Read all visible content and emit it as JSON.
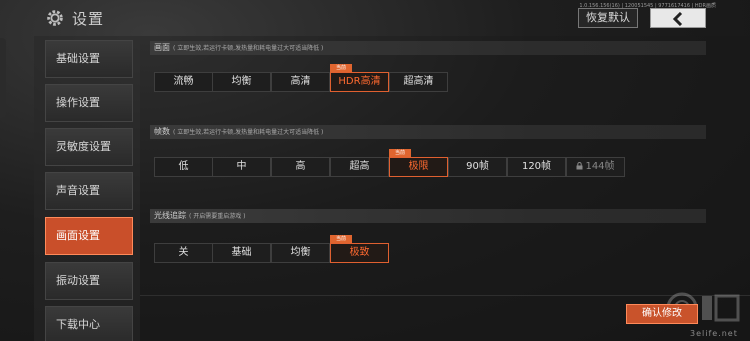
{
  "header": {
    "title": "设置",
    "version": "1.0.156.156(16) | 120051545 | 9771617416 | HDR画质",
    "reset_label": "恢复默认",
    "back_icon": "chevron-left-icon",
    "gear_icon": "gear-icon"
  },
  "sidebar": {
    "items": [
      {
        "label": "基础设置",
        "active": false
      },
      {
        "label": "操作设置",
        "active": false
      },
      {
        "label": "灵敏度设置",
        "active": false
      },
      {
        "label": "声音设置",
        "active": false
      },
      {
        "label": "画面设置",
        "active": true
      },
      {
        "label": "振动设置",
        "active": false
      },
      {
        "label": "下载中心",
        "active": false
      }
    ]
  },
  "sections": {
    "quality": {
      "title": "画面",
      "note": "( 立即生效,若运行卡顿,发热量和耗电量过大可适当降低 )",
      "options": [
        "流畅",
        "均衡",
        "高清",
        "HDR高清",
        "超高清"
      ],
      "selected": "HDR高清",
      "badge": "当前"
    },
    "fps": {
      "title": "帧数",
      "note": "( 立即生效,若运行卡顿,发热量和耗电量过大可适当降低 )",
      "options": [
        "低",
        "中",
        "高",
        "超高",
        "极限",
        "90帧",
        "120帧",
        "144帧"
      ],
      "selected": "极限",
      "locked": "144帧",
      "badge": "当前"
    },
    "raytracing": {
      "title": "光线追踪",
      "note": "( 开启需要重启游戏 )",
      "options": [
        "关",
        "基础",
        "均衡",
        "极致"
      ],
      "selected": "极致",
      "badge": "当前"
    }
  },
  "footer": {
    "confirm_label": "确认修改"
  },
  "watermark": {
    "text": "3elife.net"
  },
  "colors": {
    "accent": "#e0652f",
    "active_sidebar": "#c94f2a",
    "background": "#1e1e1e"
  }
}
